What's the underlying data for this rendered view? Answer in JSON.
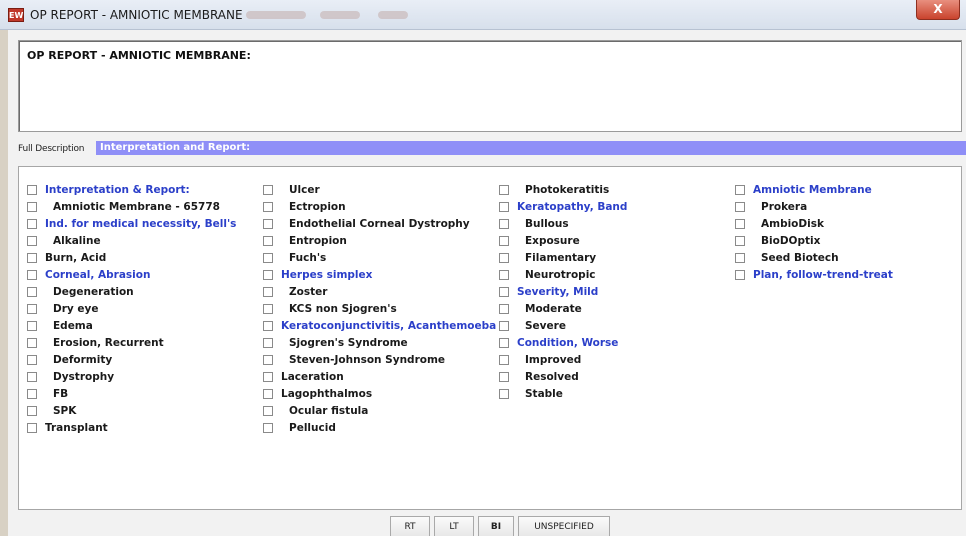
{
  "window": {
    "title": "OP REPORT - AMNIOTIC MEMBRANE",
    "icon": "EW",
    "close_label": "X"
  },
  "report": {
    "text": "OP REPORT - AMNIOTIC MEMBRANE:"
  },
  "description": {
    "label": "Full Description",
    "value": "Interpretation and Report:"
  },
  "columns": [
    [
      {
        "label": "Interpretation & Report:",
        "style": "blue"
      },
      {
        "label": "Amniotic Membrane - 65778",
        "style": "ind"
      },
      {
        "label": "Ind. for medical necessity, Bell's",
        "style": "blue"
      },
      {
        "label": "Alkaline",
        "style": "ind"
      },
      {
        "label": "Burn, Acid",
        "style": "normal"
      },
      {
        "label": "Corneal, Abrasion",
        "style": "blue"
      },
      {
        "label": "Degeneration",
        "style": "ind"
      },
      {
        "label": "Dry eye",
        "style": "ind"
      },
      {
        "label": "Edema",
        "style": "ind"
      },
      {
        "label": "Erosion, Recurrent",
        "style": "ind"
      },
      {
        "label": "Deformity",
        "style": "ind"
      },
      {
        "label": "Dystrophy",
        "style": "ind"
      },
      {
        "label": "FB",
        "style": "ind"
      },
      {
        "label": "SPK",
        "style": "ind"
      },
      {
        "label": "Transplant",
        "style": "normal"
      }
    ],
    [
      {
        "label": "Ulcer",
        "style": "ind"
      },
      {
        "label": "Ectropion",
        "style": "ind"
      },
      {
        "label": "Endothelial Corneal Dystrophy",
        "style": "ind"
      },
      {
        "label": "Entropion",
        "style": "ind"
      },
      {
        "label": "Fuch's",
        "style": "ind"
      },
      {
        "label": "Herpes simplex",
        "style": "blue"
      },
      {
        "label": "Zoster",
        "style": "ind"
      },
      {
        "label": "KCS non Sjogren's",
        "style": "ind"
      },
      {
        "label": "Keratoconjunctivitis, Acanthemoeba",
        "style": "blue"
      },
      {
        "label": "Sjogren's Syndrome",
        "style": "ind"
      },
      {
        "label": "Steven-Johnson Syndrome",
        "style": "ind"
      },
      {
        "label": "Laceration",
        "style": "normal"
      },
      {
        "label": "Lagophthalmos",
        "style": "normal"
      },
      {
        "label": "Ocular fistula",
        "style": "ind"
      },
      {
        "label": "Pellucid",
        "style": "ind"
      }
    ],
    [
      {
        "label": "Photokeratitis",
        "style": "ind"
      },
      {
        "label": "Keratopathy, Band",
        "style": "blue"
      },
      {
        "label": "Bullous",
        "style": "ind"
      },
      {
        "label": "Exposure",
        "style": "ind"
      },
      {
        "label": "Filamentary",
        "style": "ind"
      },
      {
        "label": "Neurotropic",
        "style": "ind"
      },
      {
        "label": "Severity, Mild",
        "style": "blue"
      },
      {
        "label": "Moderate",
        "style": "ind"
      },
      {
        "label": "Severe",
        "style": "ind"
      },
      {
        "label": "Condition, Worse",
        "style": "blue"
      },
      {
        "label": "Improved",
        "style": "ind"
      },
      {
        "label": "Resolved",
        "style": "ind"
      },
      {
        "label": "Stable",
        "style": "ind"
      }
    ],
    [
      {
        "label": "Amniotic Membrane",
        "style": "blue"
      },
      {
        "label": "Prokera",
        "style": "ind"
      },
      {
        "label": "AmbioDisk",
        "style": "ind"
      },
      {
        "label": "BioDOptix",
        "style": "ind"
      },
      {
        "label": "Seed Biotech",
        "style": "ind"
      },
      {
        "label": "Plan, follow-trend-treat",
        "style": "blue"
      }
    ]
  ],
  "buttons": [
    {
      "label": "RT",
      "bold": false
    },
    {
      "label": "LT",
      "bold": false
    },
    {
      "label": "BI",
      "bold": true
    },
    {
      "label": "UNSPECIFIED",
      "bold": false
    }
  ]
}
